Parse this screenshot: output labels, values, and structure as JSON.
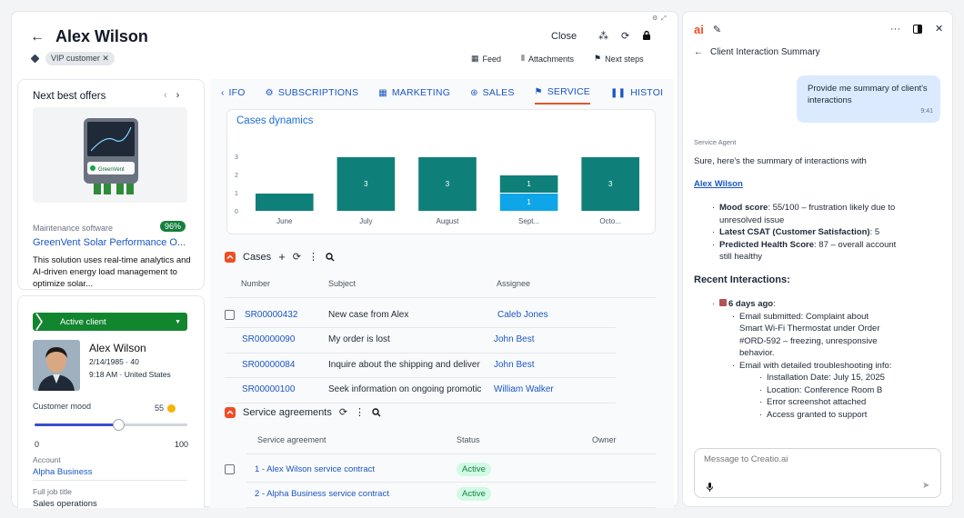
{
  "header": {
    "title": "Alex Wilson",
    "tag": "VIP customer",
    "close_label": "Close",
    "feed_label": "Feed",
    "attachments_label": "Attachments",
    "next_steps_label": "Next steps"
  },
  "offers": {
    "title": "Next best offers",
    "category": "Maintenance software",
    "match": "96%",
    "product_name": "GreenVent Solar Performance O...",
    "description": "This solution uses real-time analytics and AI-driven energy load management to optimize solar...",
    "brand": "GreenVent"
  },
  "profile": {
    "status": "Active client",
    "name": "Alex Wilson",
    "dob": "2/14/1985 · 40",
    "local_time": "9:18 AM · United States",
    "mood_label": "Customer mood",
    "mood_value": "55",
    "mood_fraction": 0.55,
    "slider_min": "0",
    "slider_max": "100",
    "account_label": "Account",
    "account_value": "Alpha Business",
    "job_label": "Full job title",
    "job_value": "Sales operations"
  },
  "tabs": [
    {
      "label": "IFO",
      "icon": "chevron-left-icon"
    },
    {
      "label": "SUBSCRIPTIONS",
      "icon": "gear-icon"
    },
    {
      "label": "MARKETING",
      "icon": "calendar-icon"
    },
    {
      "label": "SALES",
      "icon": "sales-icon"
    },
    {
      "label": "SERVICE",
      "icon": "flag-icon",
      "active": true
    },
    {
      "label": "HISTOI",
      "icon": "history-icon"
    }
  ],
  "chart_data": {
    "type": "bar",
    "title": "Cases dynamics",
    "categories": [
      "June",
      "July",
      "August",
      "Sept...",
      "Octo..."
    ],
    "series": [
      {
        "values": [
          1,
          3,
          3,
          1,
          3
        ],
        "color": "#0f7f7a"
      },
      {
        "values": [
          0,
          0,
          0,
          1,
          0
        ],
        "color": "#0ea5e9"
      }
    ],
    "stacked": true,
    "y_ticks": [
      "0",
      "1",
      "2",
      "3"
    ],
    "ylim": [
      0,
      3.2
    ],
    "labels": [
      {
        "category": "July",
        "series": 0,
        "text": "3"
      },
      {
        "category": "August",
        "series": 0,
        "text": "3"
      },
      {
        "category": "Sept...",
        "series": 0,
        "text": "1"
      },
      {
        "category": "Sept...",
        "series": 1,
        "text": "1"
      },
      {
        "category": "Octo...",
        "series": 0,
        "text": "3"
      }
    ]
  },
  "cases": {
    "title": "Cases",
    "columns": [
      "Number",
      "Subject",
      "Assignee"
    ],
    "rows": [
      {
        "number": "SR00000432",
        "subject": "New case from Alex",
        "assignee": "Caleb Jones"
      },
      {
        "number": "SR00000090",
        "subject": "My order is lost",
        "assignee": "John Best"
      },
      {
        "number": "SR00000084",
        "subject": "Inquire about the shipping and deliver",
        "assignee": "John Best"
      },
      {
        "number": "SR00000100",
        "subject": "Seek information on ongoing promotic",
        "assignee": "William Walker"
      }
    ]
  },
  "agreements": {
    "title": "Service agreements",
    "columns": [
      "Service agreement",
      "Status",
      "Owner"
    ],
    "rows": [
      {
        "name": "1 - Alex Wilson service contract",
        "status": "Active"
      },
      {
        "name": "2 - Alpha Business service contract",
        "status": "Active"
      }
    ]
  },
  "chat": {
    "back_label": "Client Interaction Summary",
    "user_message": "Provide me summary of client's interactions",
    "user_time": "9:41",
    "agent_name": "Service Agent",
    "intro": "Sure, here's the summary of interactions with",
    "client_link": "Alex Wilson",
    "bullets": [
      {
        "bold": "Mood score",
        "text": ": 55/100 – frustration likely due to unresolved issue"
      },
      {
        "bold": "Latest CSAT (Customer Satisfaction)",
        "text": ": 5"
      },
      {
        "bold": "Predicted Health Score",
        "text": ": 87 – overall account still healthy"
      }
    ],
    "recent_heading": "Recent Interactions:",
    "recent_when": "6 days ago",
    "recent_items": [
      "Email submitted: Complaint about Smart Wi-Fi Thermostat under Order #ORD-592 – freezing, unresponsive behavior.",
      "Email with detailed troubleshooting info:"
    ],
    "details": [
      "Installation Date: July 15, 2025",
      "Location: Conference Room B",
      "Error screenshot attached",
      "Access granted to support"
    ],
    "input_placeholder": "Message to Creatio.ai"
  }
}
